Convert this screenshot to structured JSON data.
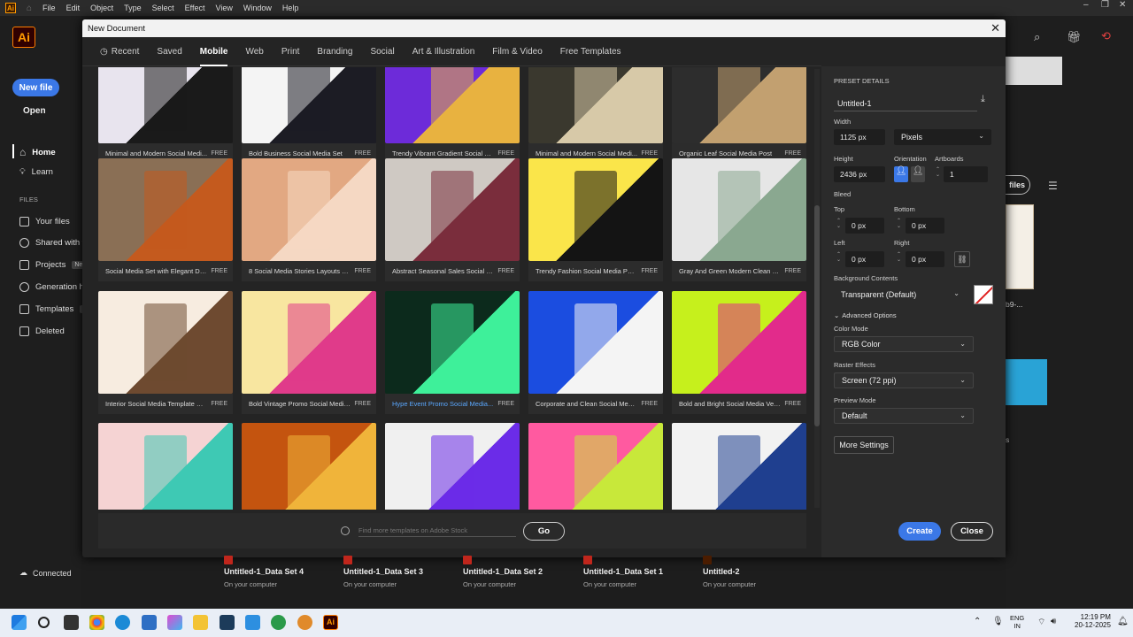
{
  "menubar": {
    "items": [
      "File",
      "Edit",
      "Object",
      "Type",
      "Select",
      "Effect",
      "View",
      "Window",
      "Help"
    ]
  },
  "app": {
    "logo": "Ai",
    "new_file": "New file",
    "open": "Open",
    "nav": [
      {
        "label": "Home",
        "icon": "home-icon"
      },
      {
        "label": "Learn",
        "icon": "bulb-icon"
      }
    ],
    "files_header": "FILES",
    "files": [
      {
        "label": "Your files",
        "icon": "file-icon"
      },
      {
        "label": "Shared with y",
        "icon": "share-icon"
      },
      {
        "label": "Projects",
        "icon": "folder-icon",
        "badge": "New"
      },
      {
        "label": "Generation hi",
        "icon": "sparkle-icon"
      },
      {
        "label": "Templates",
        "icon": "template-icon",
        "badge": "N"
      },
      {
        "label": "Deleted",
        "icon": "trash-icon"
      }
    ],
    "connected": "Connected",
    "right_strip": {
      "files_btn": "files",
      "item1": "b9-...",
      "item2": "s"
    }
  },
  "modal": {
    "title": "New Document",
    "tabs": [
      {
        "label": "Recent",
        "icon": "clock-icon"
      },
      {
        "label": "Saved"
      },
      {
        "label": "Mobile",
        "active": true
      },
      {
        "label": "Web"
      },
      {
        "label": "Print"
      },
      {
        "label": "Branding"
      },
      {
        "label": "Social"
      },
      {
        "label": "Art & Illustration"
      },
      {
        "label": "Film & Video"
      },
      {
        "label": "Free Templates"
      }
    ],
    "search_placeholder": "Find more templates on Adobe Stock",
    "go": "Go",
    "templates": [
      {
        "title": "Minimal and Modern Social Medi...",
        "tag": "FREE",
        "colors": [
          "#e8e4ee",
          "#1a1a1a"
        ]
      },
      {
        "title": "Bold Business Social Media Set",
        "tag": "FREE",
        "colors": [
          "#f4f4f4",
          "#1c1c24"
        ]
      },
      {
        "title": "Trendy Vibrant Gradient Social M...",
        "tag": "FREE",
        "colors": [
          "#6d2bd9",
          "#e8b240"
        ]
      },
      {
        "title": "Minimal and Modern Social Medi...",
        "tag": "FREE",
        "colors": [
          "#3a382e",
          "#d7c9a8"
        ]
      },
      {
        "title": "Organic Leaf Social Media Post",
        "tag": "FREE",
        "colors": [
          "#2d2d2d",
          "#c2a070"
        ]
      },
      {
        "title": "Social Media Set with Elegant De...",
        "tag": "FREE",
        "colors": [
          "#8a6f55",
          "#c45a1e"
        ]
      },
      {
        "title": "8 Social Media Stories Layouts wi...",
        "tag": "FREE",
        "colors": [
          "#e2a882",
          "#f5d8c3"
        ]
      },
      {
        "title": "Abstract Seasonal Sales Social Set",
        "tag": "FREE",
        "colors": [
          "#cfc9c3",
          "#7a2d3c"
        ]
      },
      {
        "title": "Trendy Fashion Social Media Post...",
        "tag": "FREE",
        "colors": [
          "#fae54a",
          "#141414"
        ]
      },
      {
        "title": "Gray And Green Modern Clean St...",
        "tag": "FREE",
        "colors": [
          "#e6e6e6",
          "#8aa890"
        ]
      },
      {
        "title": "Interior Social Media Template RGB",
        "tag": "FREE",
        "colors": [
          "#f7ece0",
          "#6e4a30"
        ]
      },
      {
        "title": "Bold Vintage Promo Social Media...",
        "tag": "FREE",
        "colors": [
          "#f8e6a0",
          "#e03b8a"
        ]
      },
      {
        "title": "Hype Event Promo Social Media...",
        "tag": "FREE",
        "link": true,
        "colors": [
          "#0c2a1c",
          "#3ef09a"
        ]
      },
      {
        "title": "Corporate and Clean Social Medi...",
        "tag": "FREE",
        "colors": [
          "#1b4de0",
          "#f4f4f4"
        ]
      },
      {
        "title": "Bold and Bright Social Media Ver...",
        "tag": "FREE",
        "colors": [
          "#c6f01c",
          "#e22b8b"
        ]
      },
      {
        "title": "",
        "tag": "",
        "colors": [
          "#f5d3d3",
          "#3ec9b4"
        ]
      },
      {
        "title": "",
        "tag": "",
        "colors": [
          "#c4540f",
          "#f0b43a"
        ]
      },
      {
        "title": "",
        "tag": "",
        "colors": [
          "#f0f0f0",
          "#6b2ce8"
        ]
      },
      {
        "title": "",
        "tag": "",
        "colors": [
          "#ff5aa0",
          "#c8e83a"
        ]
      },
      {
        "title": "",
        "tag": "",
        "colors": [
          "#f2f2f2",
          "#1f3f8f"
        ]
      }
    ]
  },
  "preset": {
    "header": "PRESET DETAILS",
    "name": "Untitled-1",
    "width_label": "Width",
    "width": "1125 px",
    "units": "Pixels",
    "height_label": "Height",
    "height": "2436 px",
    "orientation_label": "Orientation",
    "artboards_label": "Artboards",
    "artboards": "1",
    "bleed_label": "Bleed",
    "top_label": "Top",
    "top": "0 px",
    "bottom_label": "Bottom",
    "bottom": "0 px",
    "left_label": "Left",
    "left": "0 px",
    "right_label": "Right",
    "right": "0 px",
    "bg_label": "Background Contents",
    "bg": "Transparent (Default)",
    "advanced": "Advanced Options",
    "color_mode_label": "Color Mode",
    "color_mode": "RGB Color",
    "raster_label": "Raster Effects",
    "raster": "Screen (72 ppi)",
    "preview_label": "Preview Mode",
    "preview": "Default",
    "more": "More Settings",
    "create": "Create",
    "close": "Close"
  },
  "recent_files": [
    {
      "name": "Untitled-1_Data Set 4",
      "sub": "On your computer"
    },
    {
      "name": "Untitled-1_Data Set 3",
      "sub": "On your computer"
    },
    {
      "name": "Untitled-1_Data Set 2",
      "sub": "On your computer"
    },
    {
      "name": "Untitled-1_Data Set 1",
      "sub": "On your computer"
    },
    {
      "name": "Untitled-2",
      "sub": "On your computer"
    }
  ],
  "taskbar": {
    "lang1": "ENG",
    "lang2": "IN",
    "time": "12:19 PM",
    "date": "20-12-2025"
  }
}
